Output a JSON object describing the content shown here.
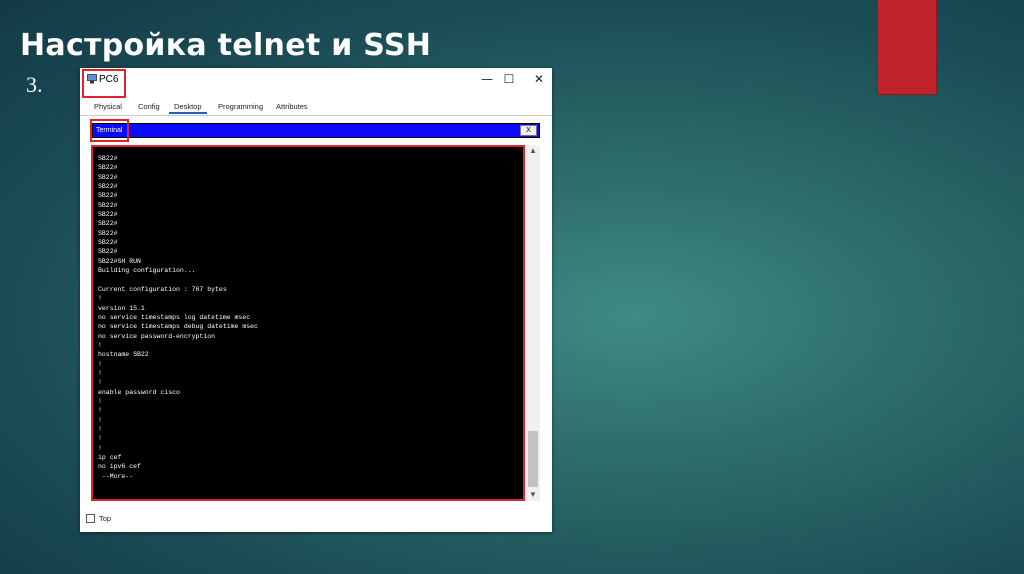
{
  "slide": {
    "title": "Настройка telnet и SSH",
    "step_number": "3."
  },
  "window": {
    "title": "PC6",
    "icon": "pc-icon",
    "controls": {
      "minimize": "—",
      "maximize": "☐",
      "close": "✕"
    },
    "tabs": [
      {
        "label": "Physical"
      },
      {
        "label": "Config"
      },
      {
        "label": "Desktop",
        "active": true
      },
      {
        "label": "Programming"
      },
      {
        "label": "Attributes"
      }
    ],
    "terminal": {
      "header_label": "Terminal",
      "close_label": "X",
      "lines": [
        "SB22#",
        "SB22#",
        "SB22#",
        "SB22#",
        "SB22#",
        "SB22#",
        "SB22#",
        "SB22#",
        "SB22#",
        "SB22#",
        "SB22#",
        "SB22#SH RUN",
        "Building configuration...",
        "",
        "Current configuration : 767 bytes",
        "!",
        "version 15.1",
        "no service timestamps log datetime msec",
        "no service timestamps debug datetime msec",
        "no service password-encryption",
        "!",
        "hostname SB22",
        "!",
        "!",
        "!",
        "enable password cisco",
        "!",
        "!",
        "!",
        "!",
        "!",
        "!",
        "ip cef",
        "no ipv6 cef",
        " --More--"
      ]
    },
    "footer": {
      "checkbox_label": "Top"
    }
  },
  "colors": {
    "highlight": "#e0242b",
    "terminal_header": "#0a0aff",
    "deco_bar": "#c0242a"
  }
}
